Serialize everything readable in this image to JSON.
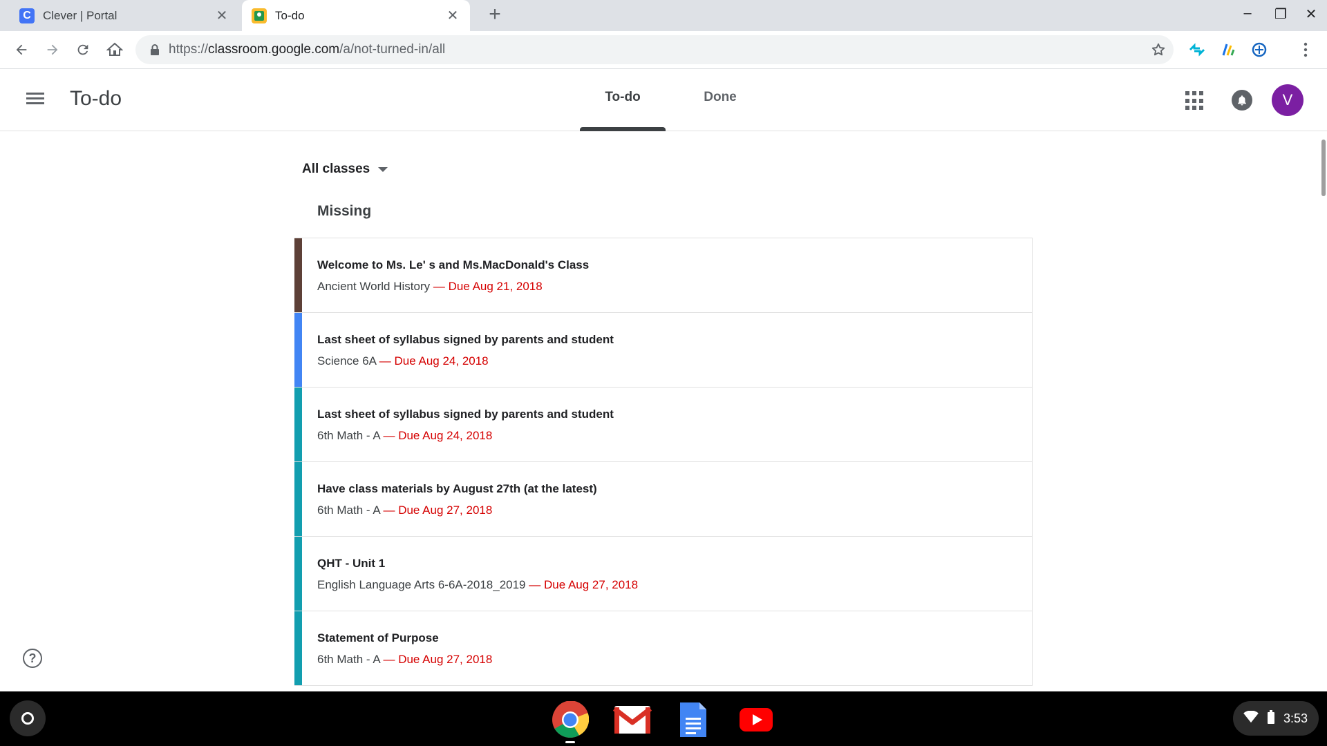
{
  "browser": {
    "tabs": [
      {
        "title": "Clever | Portal",
        "favicon": "C"
      },
      {
        "title": "To-do"
      }
    ],
    "url": {
      "scheme": "https://",
      "host": "classroom.google.com",
      "path": "/a/not-turned-in/all"
    }
  },
  "header": {
    "title": "To-do",
    "tabs": [
      {
        "label": "To-do"
      },
      {
        "label": "Done"
      }
    ],
    "avatar_letter": "V"
  },
  "filter": {
    "selected": "All classes"
  },
  "section": {
    "title": "Missing"
  },
  "assignments": [
    {
      "title": "Welcome to Ms. Le' s and Ms.MacDonald's Class",
      "class": "Ancient World History",
      "due": "— Due Aug 21, 2018",
      "color": "#5d4037"
    },
    {
      "title": "Last sheet of syllabus signed by parents and student",
      "class": "Science 6A",
      "due": "— Due Aug 24, 2018",
      "color": "#4285f4"
    },
    {
      "title": "Last sheet of syllabus signed by parents and student",
      "class": "6th Math - A",
      "due": "— Due Aug 24, 2018",
      "color": "#129eaf"
    },
    {
      "title": "Have class materials by August 27th (at the latest)",
      "class": "6th Math - A",
      "due": "— Due Aug 27, 2018",
      "color": "#129eaf"
    },
    {
      "title": "QHT - Unit 1",
      "class": "English Language Arts 6-6A-2018_2019",
      "due": "— Due Aug 27, 2018",
      "color": "#129eaf"
    },
    {
      "title": "Statement of Purpose",
      "class": "6th Math - A",
      "due": "— Due Aug 27, 2018",
      "color": "#129eaf"
    }
  ],
  "shelf": {
    "apps": [
      "chrome-icon",
      "gmail-icon",
      "docs-icon",
      "youtube-icon"
    ],
    "time": "3:53"
  },
  "colors": {
    "due_red": "#d50000",
    "avatar_purple": "#7b1fa2"
  }
}
